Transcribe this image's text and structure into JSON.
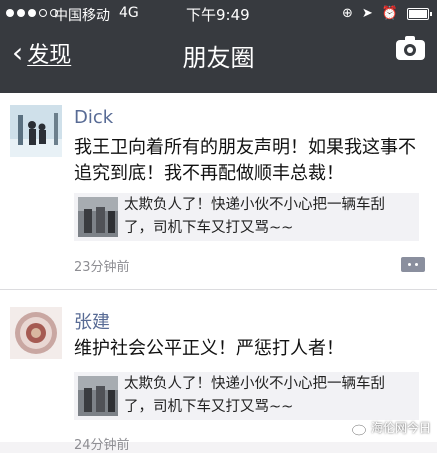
{
  "status_bar": {
    "carrier": "中国移动",
    "network": "4G",
    "time": "下午9:49"
  },
  "nav": {
    "back_label": "发现",
    "title": "朋友圈"
  },
  "posts": [
    {
      "author": "Dick",
      "text": "我王卫向着所有的朋友声明！如果我这事不追究到底！我不再配做顺丰总裁！",
      "shared_text": "太欺负人了！快递小伙不小心把一辆车刮了，司机下车又打又骂~~",
      "time": "23分钟前"
    },
    {
      "author": "张建",
      "text": "维护社会公平正义！严惩打人者！",
      "shared_text": "太欺负人了！快递小伙不小心把一辆车刮了，司机下车又打又骂~~",
      "time": "24分钟前"
    }
  ],
  "watermark": "海伦网今日",
  "colors": {
    "header_bg": "#373a3f",
    "author_name": "#586b95",
    "share_bg": "#f2f2f5"
  }
}
